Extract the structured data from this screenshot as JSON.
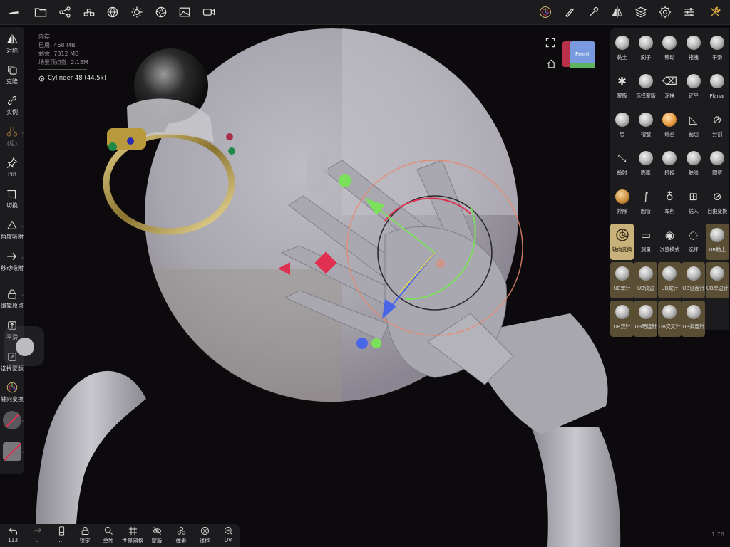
{
  "memory": {
    "title": "内存",
    "used": "已用: 468 MB",
    "free": "剩余: 7312 MB",
    "vertices": "场景顶点数: 2.15M",
    "object": "Cylinder 48 (44.5k)"
  },
  "navcube": {
    "face": "Front"
  },
  "left_toolbar": {
    "items": [
      {
        "label": "对称",
        "icon": "symmetry-icon"
      },
      {
        "label": "克隆",
        "icon": "clone-icon"
      },
      {
        "label": "实例",
        "icon": "link-icon"
      },
      {
        "label": "(组)",
        "icon": "group-icon"
      },
      {
        "label": "Pin",
        "icon": "pin-icon"
      },
      {
        "label": "切换",
        "icon": "switch-icon"
      },
      {
        "label": "角度吸附",
        "icon": "angle-snap-icon"
      },
      {
        "label": "移动吸附",
        "icon": "move-snap-icon"
      },
      {
        "label": "编辑原点",
        "icon": "lock-icon"
      },
      {
        "label": "平滑",
        "icon": "smooth-icon"
      },
      {
        "label": "选择蒙版",
        "icon": "select-mask-icon"
      },
      {
        "label": "轴向变换",
        "icon": "gizmo-icon"
      }
    ]
  },
  "tools": [
    {
      "label": "黏土"
    },
    {
      "label": "刷子"
    },
    {
      "label": "移动"
    },
    {
      "label": "拖拽"
    },
    {
      "label": "平滑"
    },
    {
      "label": "蒙版"
    },
    {
      "label": "选择蒙版"
    },
    {
      "label": "涂抹"
    },
    {
      "label": "铲平"
    },
    {
      "label": "Planar"
    },
    {
      "label": "层"
    },
    {
      "label": "褶皱"
    },
    {
      "label": "绘画"
    },
    {
      "label": "裁切"
    },
    {
      "label": "分割"
    },
    {
      "label": "投射"
    },
    {
      "label": "膨胀"
    },
    {
      "label": "挤捏"
    },
    {
      "label": "触碰"
    },
    {
      "label": "图章"
    },
    {
      "label": "排除"
    },
    {
      "label": "圆管"
    },
    {
      "label": "车削"
    },
    {
      "label": "插入"
    },
    {
      "label": "自由变换"
    },
    {
      "label": "轴向变换"
    },
    {
      "label": "测量"
    },
    {
      "label": "浏览模式"
    },
    {
      "label": "选择"
    },
    {
      "label": "UB黏土"
    },
    {
      "label": "UB单针"
    },
    {
      "label": "UB锁边"
    },
    {
      "label": "UB藏针"
    },
    {
      "label": "UB锯连针"
    },
    {
      "label": "UB单边针"
    },
    {
      "label": "UB双针"
    },
    {
      "label": "UB暗连针"
    },
    {
      "label": "UB交叉针"
    },
    {
      "label": "UB斜连针"
    }
  ],
  "bottom_bar": {
    "items": [
      {
        "label": "113"
      },
      {
        "label": "0"
      },
      {
        "label": "..."
      },
      {
        "label": "锁定"
      },
      {
        "label": "单独"
      },
      {
        "label": "世界网格"
      },
      {
        "label": "蒙版"
      },
      {
        "label": "体素"
      },
      {
        "label": "线框"
      },
      {
        "label": "UV"
      }
    ]
  },
  "version": "1.76",
  "colors": {
    "accent": "#c9b27a",
    "toolbar_bg": "#1c1b1d",
    "gizmo_green": "#7be05a",
    "gizmo_blue": "#4a66e8",
    "gizmo_red": "#e0304f"
  }
}
